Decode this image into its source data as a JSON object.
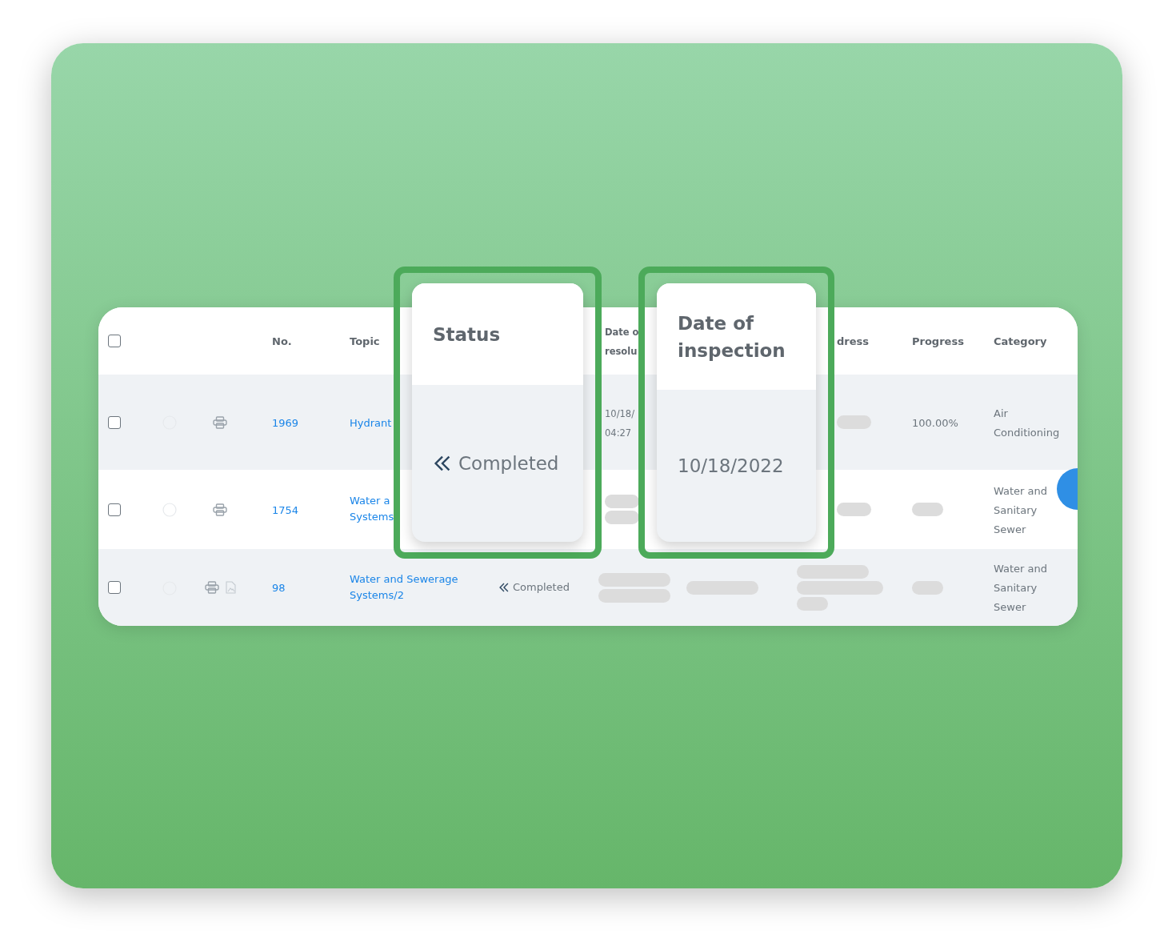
{
  "table": {
    "select_all": {
      "checked": false
    },
    "columns": [
      {
        "label": [
          "No."
        ]
      },
      {
        "label": [
          "Topic"
        ]
      },
      {
        "label": [
          "Date o",
          "resolu"
        ]
      },
      {
        "label": [
          "dress"
        ]
      },
      {
        "label": [
          "Progress"
        ]
      },
      {
        "label": [
          "Category"
        ]
      }
    ],
    "rows": [
      {
        "checked": false,
        "has_attachment": false,
        "number": "1969",
        "topic": [
          "Hydrant"
        ],
        "resolution": {
          "kind": "text",
          "lines": [
            "10/18/",
            "04:27"
          ]
        },
        "address": {
          "kind": "loading"
        },
        "progress": {
          "kind": "text",
          "lines": [
            "100.00%"
          ]
        },
        "category": [
          "Air",
          "Conditioning"
        ]
      },
      {
        "checked": false,
        "has_attachment": false,
        "number": "1754",
        "topic": [
          "Water a",
          "Systems"
        ],
        "resolution": {
          "kind": "loading_double"
        },
        "address": {
          "kind": "loading"
        },
        "progress": {
          "kind": "loading"
        },
        "category": [
          "Water and",
          "Sanitary",
          "Sewer"
        ]
      },
      {
        "checked": false,
        "has_attachment": true,
        "number": "98",
        "topic": [
          "Water and Sewerage",
          "Systems/2"
        ],
        "status": "Completed",
        "resolution": {
          "kind": "loading_double"
        },
        "inspection": {
          "kind": "loading"
        },
        "address": {
          "kind": "loading_triple"
        },
        "progress": {
          "kind": "loading"
        },
        "category": [
          "Water and",
          "Sanitary",
          "Sewer"
        ]
      }
    ]
  },
  "callouts": [
    {
      "kind": "status",
      "heading": "Status",
      "value": "Completed"
    },
    {
      "kind": "date",
      "heading": "Date of inspection",
      "value": "10/18/2022"
    }
  ]
}
